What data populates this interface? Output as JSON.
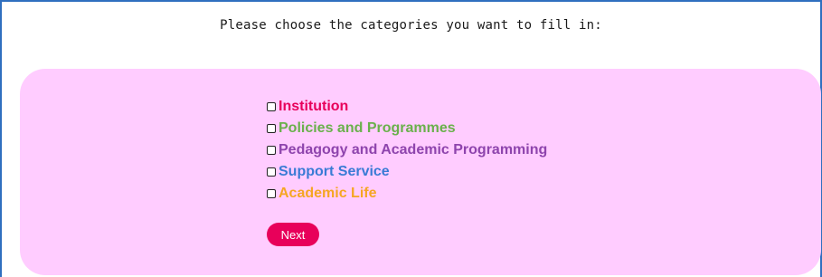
{
  "form": {
    "prompt": "Please choose the categories you want to fill in:",
    "categories": [
      {
        "label": "Institution",
        "color": "#e8005a",
        "checked": false
      },
      {
        "label": "Policies and Programmes",
        "color": "#6ab04c",
        "checked": false
      },
      {
        "label": "Pedagogy and Academic Programming",
        "color": "#8e44ad",
        "checked": false
      },
      {
        "label": "Support Service",
        "color": "#3a7bd5",
        "checked": false
      },
      {
        "label": "Academic Life",
        "color": "#f5a623",
        "checked": false
      }
    ],
    "next_label": "Next"
  },
  "colors": {
    "panel_background": "#ffccff",
    "frame_border": "#2f6fbf",
    "next_button": "#e8005a"
  }
}
